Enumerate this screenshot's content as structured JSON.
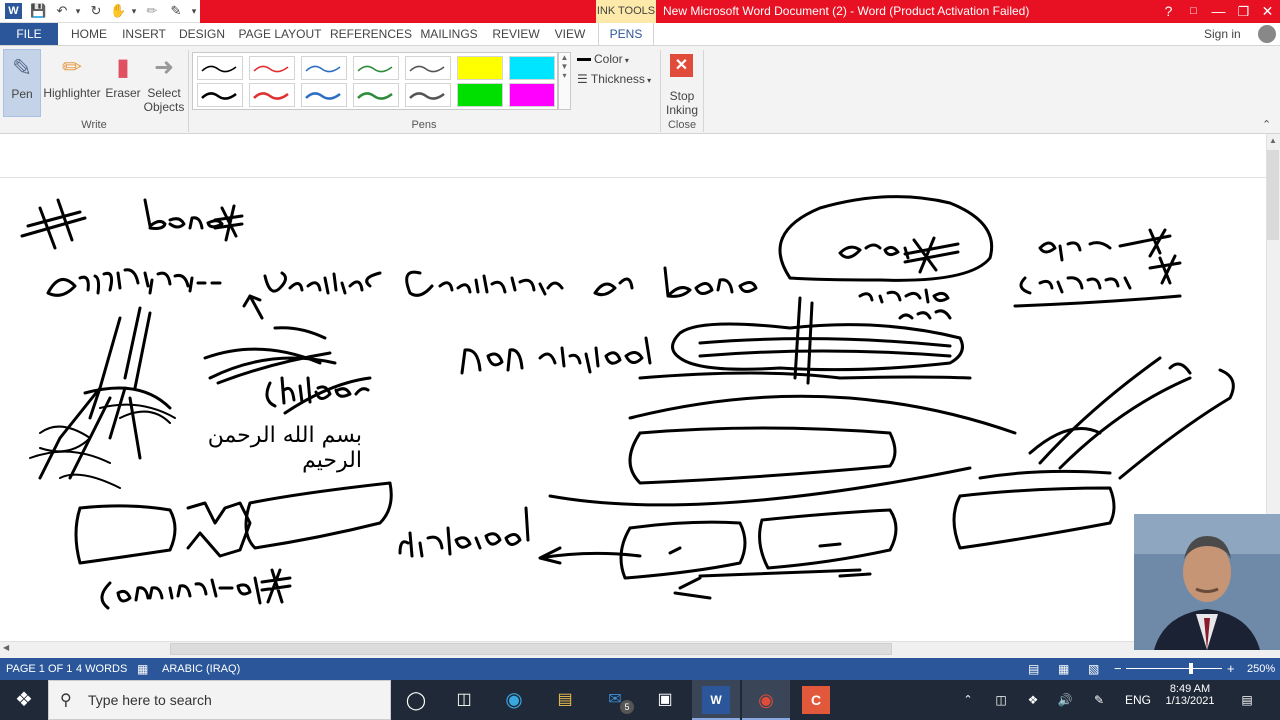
{
  "titlebar": {
    "app_logo": "W",
    "ink_tools_label": "INK TOOLS",
    "document_title": "New Microsoft Word Document (2) -  Word (Product Activation Failed)",
    "help": "?"
  },
  "tabs": {
    "file": "FILE",
    "items": [
      "HOME",
      "INSERT",
      "DESIGN",
      "PAGE LAYOUT",
      "REFERENCES",
      "MAILINGS",
      "REVIEW",
      "VIEW",
      "PENS"
    ],
    "sign_in": "Sign in"
  },
  "ribbon": {
    "write": {
      "pen": "Pen",
      "highlighter": "Highlighter",
      "eraser": "Eraser",
      "select_objects_1": "Select",
      "select_objects_2": "Objects",
      "group_label": "Write"
    },
    "pens": {
      "color": "Color",
      "thickness": "Thickness",
      "group_label": "Pens",
      "swatch_colors": [
        "#000000",
        "#e03030",
        "#2d6fc2",
        "#2e8b3a",
        "#555555",
        "#ffff00",
        "#00e5ff",
        "#000000",
        "#e03030",
        "#2d6fc2",
        "#2e8b3a",
        "#555555",
        "#00e000",
        "#ff00ff"
      ]
    },
    "close": {
      "stop_inking_1": "Stop",
      "stop_inking_2": "Inking",
      "group_label": "Close"
    }
  },
  "document": {
    "arabic_text": "بسم الله الرحمن الرحيم",
    "ink_words": [
      "bone",
      "Definition:- break in Continuity of bone",
      "closed",
      "open",
      "Compound",
      "simple",
      "non displaced",
      "Children",
      "displaced",
      "Cominuted"
    ]
  },
  "statusbar": {
    "page": "PAGE 1 OF 1",
    "words": "4 WORDS",
    "language": "ARABIC (IRAQ)",
    "zoom": "250%"
  },
  "taskbar": {
    "search_placeholder": "Type here to search",
    "mail_badge": "5",
    "lang": "ENG",
    "time": "8:49 AM",
    "date": "1/13/2021"
  }
}
